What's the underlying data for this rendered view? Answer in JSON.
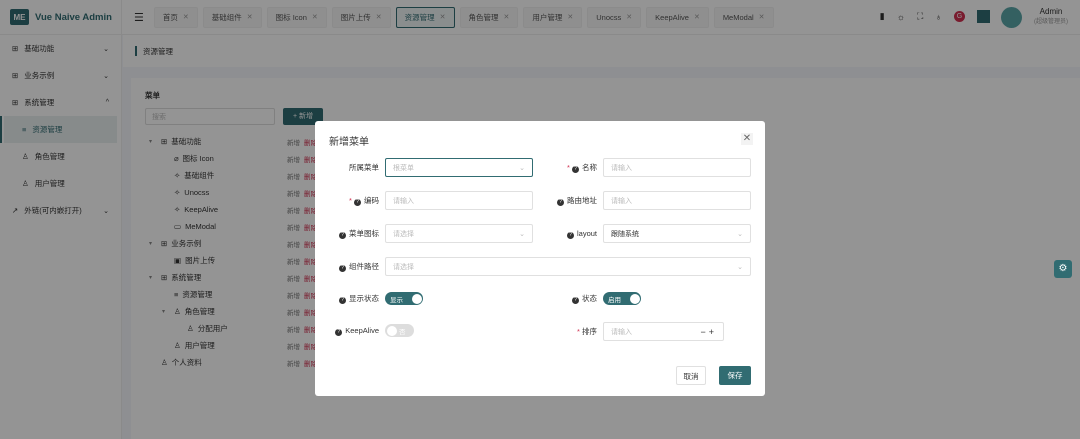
{
  "app": {
    "title": "Vue Naive Admin",
    "logo": "ME"
  },
  "header": {
    "tabs": [
      {
        "label": "首页"
      },
      {
        "label": "基础组件"
      },
      {
        "label": "图标 Icon"
      },
      {
        "label": "图片上传"
      },
      {
        "label": "资源管理",
        "active": true
      },
      {
        "label": "角色管理"
      },
      {
        "label": "用户管理"
      },
      {
        "label": "Unocss"
      },
      {
        "label": "KeepAlive"
      },
      {
        "label": "MeModal"
      }
    ],
    "icons": [
      "doc-icon",
      "sun-icon",
      "fullscreen-icon",
      "github-icon",
      "gitee-icon",
      "theme-color-icon"
    ],
    "user": {
      "name": "Admin",
      "role": "(超级管理员)"
    }
  },
  "sidebar": {
    "items": [
      {
        "label": "基础功能",
        "icon": "grid-icon"
      },
      {
        "label": "业务示例",
        "icon": "grid-icon"
      },
      {
        "label": "系统管理",
        "icon": "grid-icon"
      },
      {
        "label": "资源管理",
        "icon": "list-icon"
      },
      {
        "label": "角色管理",
        "icon": "user-role-icon"
      },
      {
        "label": "用户管理",
        "icon": "user-icon"
      },
      {
        "label": "外链(可内嵌打开)",
        "icon": "external-link-icon"
      }
    ]
  },
  "breadcrumb": "资源管理",
  "content": {
    "title": "菜单",
    "search_placeholder": "搜索",
    "add_label": "+ 新增",
    "op_add": "新增",
    "op_delete": "删除",
    "tree": [
      {
        "label": "基础功能",
        "level": 0,
        "arrow": true,
        "icon": "⊞"
      },
      {
        "label": "图标 Icon",
        "level": 1,
        "icon": "⌀"
      },
      {
        "label": "基础组件",
        "level": 1,
        "icon": "✧"
      },
      {
        "label": "Unocss",
        "level": 1,
        "icon": "✧"
      },
      {
        "label": "KeepAlive",
        "level": 1,
        "icon": "✧"
      },
      {
        "label": "MeModal",
        "level": 1,
        "icon": "▭"
      },
      {
        "label": "业务示例",
        "level": 0,
        "arrow": true,
        "icon": "⊞"
      },
      {
        "label": "图片上传",
        "level": 1,
        "icon": "▣"
      },
      {
        "label": "系统管理",
        "level": 0,
        "arrow": true,
        "icon": "⊞"
      },
      {
        "label": "资源管理",
        "level": 1,
        "icon": "≡"
      },
      {
        "label": "角色管理",
        "level": 1,
        "arrow": true,
        "icon": "♙"
      },
      {
        "label": "分配用户",
        "level": 2,
        "icon": "♙"
      },
      {
        "label": "用户管理",
        "level": 1,
        "icon": "♙"
      },
      {
        "label": "个人资料",
        "level": 0,
        "icon": "♙"
      }
    ]
  },
  "modal": {
    "title": "新增菜单",
    "fields": {
      "parent": {
        "label": "所属菜单",
        "placeholder": "根菜单"
      },
      "name": {
        "label": "名称",
        "placeholder": "请输入"
      },
      "code": {
        "label": "编码",
        "placeholder": "请输入"
      },
      "path": {
        "label": "路由地址",
        "placeholder": "请输入"
      },
      "icon": {
        "label": "菜单图标",
        "placeholder": "请选择"
      },
      "layout": {
        "label": "layout",
        "value": "跟随系统"
      },
      "component": {
        "label": "组件路径",
        "placeholder": "请选择"
      },
      "show": {
        "label": "显示状态",
        "value": "显示",
        "on": true
      },
      "enable": {
        "label": "状态",
        "value": "启用",
        "on": true
      },
      "keepalive": {
        "label": "KeepAlive",
        "value": "否",
        "on": false
      },
      "order": {
        "label": "排序",
        "placeholder": "请输入"
      }
    },
    "cancel": "取消",
    "save": "保存"
  },
  "colors": {
    "primary": "#316c72",
    "danger": "#d03050"
  }
}
